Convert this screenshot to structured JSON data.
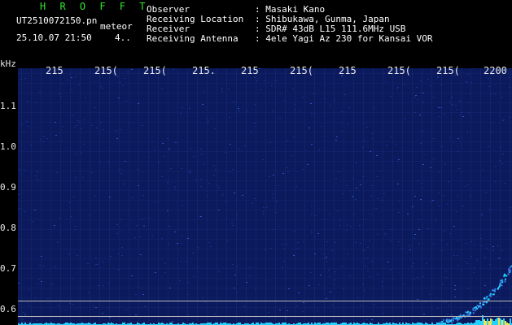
{
  "header": {
    "app_name": "H R O F F T",
    "filename": "UT2510072150.pn",
    "mode": "meteor",
    "datetime": "25.10.07 21:50",
    "count": "4..",
    "labels": [
      "Observer",
      "Receiving Location",
      "Receiver",
      "Receiving Antenna"
    ],
    "values": [
      ": Masaki Kano",
      ": Shibukawa, Gunma, Japan",
      ": SDR# 43dB L15 111.6MHz USB",
      ": 4ele Yagi Az 230 for Kansai VOR"
    ]
  },
  "x_axis": {
    "ticks": [
      "215",
      "215(",
      "215(",
      "215.",
      "215",
      "215(",
      "215",
      "215(",
      "215(",
      "2200"
    ]
  },
  "y_axis": {
    "unit": "kHz",
    "ticks": [
      "1.1",
      "1.0",
      "0.9",
      "0.8",
      "0.7",
      "0.6"
    ]
  },
  "colors": {
    "background": "#000000",
    "plot_bg": "#0b1a5c",
    "title_green": "#2ee82e",
    "grid": "#1c2e78",
    "signal_cyan": "#22d3ff",
    "signal_yellow": "#f5e04a"
  }
}
